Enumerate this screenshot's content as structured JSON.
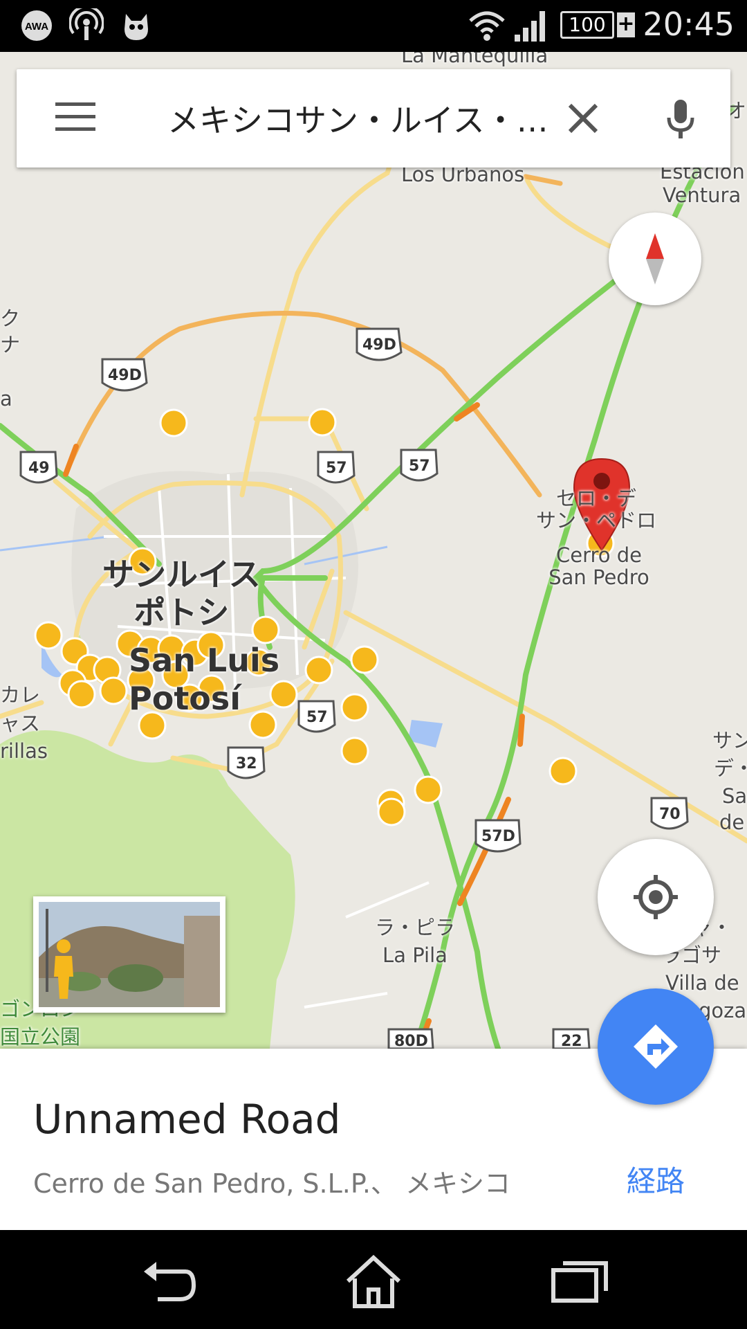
{
  "status_bar": {
    "time": "20:45",
    "battery": "100",
    "battery_plus": "+",
    "icons": [
      "awa-icon",
      "podcast-icon",
      "cat-app-icon",
      "wifi-icon",
      "signal-icon",
      "battery-icon"
    ]
  },
  "search": {
    "query": "メキシコサン・ルイス・…"
  },
  "map": {
    "labels": {
      "la_mantequilla": "La Mantequilla",
      "los_urbanos": "Los Urbanos",
      "estacion_1": "Estacion",
      "estacion_2": "Ventura",
      "city_jp_1": "サンルイス",
      "city_jp_2": "ポトシ",
      "city_es_1": "San Luis",
      "city_es_2": "Potosí",
      "cerro_jp_1": "セロ・デ",
      "cerro_jp_2": "サン・ペドロ",
      "cerro_es_1": "Cerro de",
      "cerro_es_2": "San Pedro",
      "lapila_jp": "ラ・ピラ",
      "lapila_es": "La Pila",
      "left_edge_1": "ク",
      "left_edge_2": "ナ",
      "left_edge_3": "a",
      "left_edge_4": "カレ",
      "left_edge_5": "ャス",
      "left_edge_6": "rillas",
      "right_edge_1": "オ",
      "right_edge_2": "サン",
      "right_edge_3": "デ・",
      "right_edge_4": "Sa",
      "right_edge_5": "de",
      "right_edge_6": "ャ・",
      "right_edge_7": "ラゴサ",
      "right_edge_8": "Villa de",
      "right_edge_9": "goza",
      "park_1": "ゴンロン",
      "park_2": "国立公園"
    },
    "shields": {
      "r49d_a": "49D",
      "r49d_b": "49D",
      "r49": "49",
      "r57_a": "57",
      "r57_b": "57",
      "r57_c": "57",
      "r32": "32",
      "r57d": "57D",
      "r70": "70",
      "r80d": "80D",
      "r22": "22"
    }
  },
  "place": {
    "title": "Unnamed Road",
    "address": "Cerro de San Pedro, S.L.P.、 メキシコ",
    "route_label": "経路"
  },
  "colors": {
    "accent": "#4285f4",
    "map_bg": "#ebe9e3",
    "road_yellow": "#f7dc8c",
    "road_orange": "#f0a040",
    "traffic_green": "#7ed05a",
    "pin_red": "#e0332b",
    "star_yellow": "#f6b81c"
  }
}
